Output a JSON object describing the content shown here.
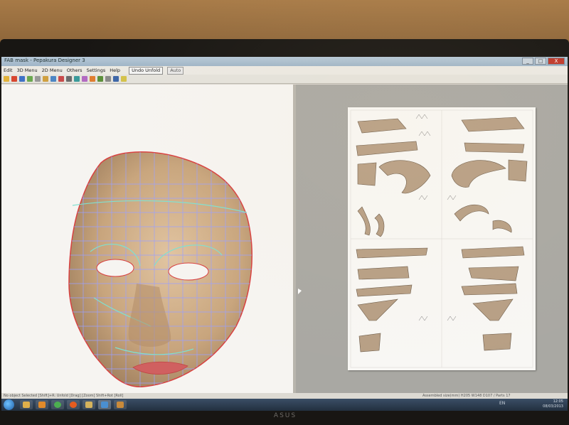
{
  "monitor": {
    "brand": "ASUS"
  },
  "window": {
    "title": "FAB mask - Pepakura Designer 3",
    "controls": [
      "_",
      "□",
      "X"
    ]
  },
  "menu": {
    "items": [
      "Edit",
      "3D Menu",
      "2D Menu",
      "Others",
      "Settings",
      "Help"
    ],
    "undo_label": "Undo Unfold",
    "auto_label": "Auto"
  },
  "status": {
    "left": "No object Selected  [Shift]+R: Unfold  [Drag] [Zoom]  Shift+Rot  [Roll]",
    "right": "Assembled size(mm) H205 W148 D107 / Parts 17"
  },
  "taskbar": {
    "apps": [
      "explorer",
      "media-player",
      "chrome",
      "firefox",
      "paint",
      "pepakura",
      "app-folder"
    ],
    "language": "EN",
    "time": "12:05",
    "date": "08/03/2013"
  },
  "colors": {
    "accent_edge": "#d84040",
    "mesh_edge": "#9aa0ff",
    "fold_edge": "#7fe0d0",
    "skin": "#c8a57d",
    "paper_part": "#b79f85"
  }
}
